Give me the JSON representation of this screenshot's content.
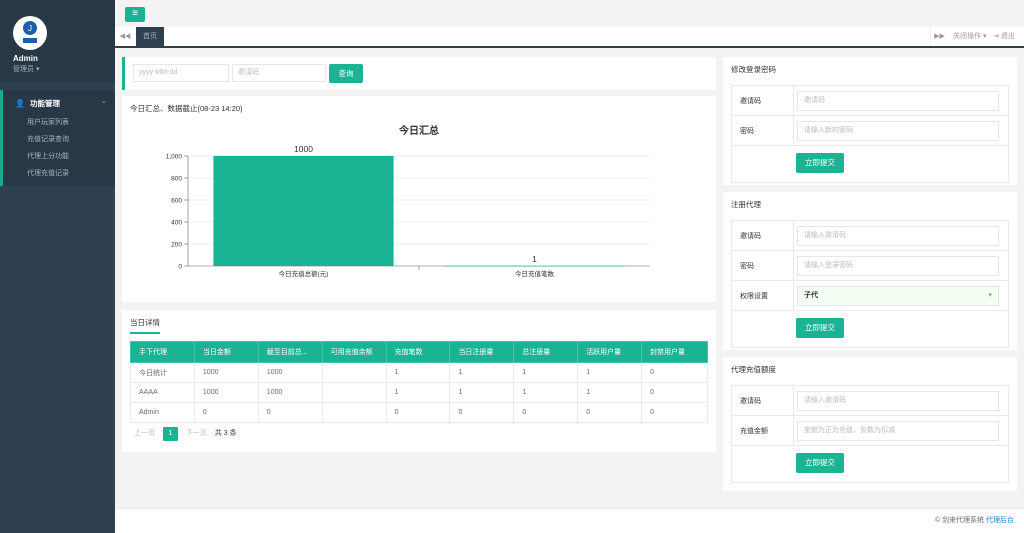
{
  "sidebar": {
    "user_name": "Admin",
    "user_role": "管理员",
    "menu_title": "功能管理",
    "items": [
      {
        "label": "用户玩家列表"
      },
      {
        "label": "充值记录查询"
      },
      {
        "label": "代理上分功能"
      },
      {
        "label": "代理充值记录"
      }
    ]
  },
  "tabs": {
    "home": "首页",
    "close_ops": "关闭操作",
    "exit": "退出"
  },
  "search": {
    "date_placeholder": "yyyy-MM-dd",
    "code_placeholder": "邀请码",
    "query_button": "查询"
  },
  "summary": {
    "header": "今日汇总、数据截止(08-23 14:20)"
  },
  "chart_data": {
    "type": "bar",
    "title": "今日汇总",
    "categories": [
      "今日充值总额(元)",
      "今日充值笔数"
    ],
    "values": [
      1000,
      1
    ],
    "data_labels": [
      "1000",
      "1"
    ],
    "yticks": [
      "0",
      "200",
      "400",
      "600",
      "800",
      "1,000"
    ],
    "ylim": [
      0,
      1000
    ],
    "color": "#1ab394",
    "grid": true
  },
  "detail": {
    "tab_label": "当日详情",
    "columns": [
      "手下代理",
      "当日金额",
      "截至目前总...",
      "可用充值余额",
      "充值笔数",
      "当日注册量",
      "总注册量",
      "活跃用户量",
      "封禁用户量"
    ],
    "rows": [
      [
        "今日统计",
        "1000",
        "1000",
        "",
        "1",
        "1",
        "1",
        "1",
        "0"
      ],
      [
        "AAAA",
        "1000",
        "1000",
        "",
        "1",
        "1",
        "1",
        "1",
        "0"
      ],
      [
        "Admin",
        "0",
        "0",
        "",
        "0",
        "0",
        "0",
        "0",
        "0"
      ]
    ],
    "pager": {
      "prev": "上一页",
      "page": "1",
      "next": "下一页",
      "total": "共 3 条"
    }
  },
  "forms": {
    "password": {
      "title": "修改登录密码",
      "code_label": "邀请码",
      "code_placeholder": "邀请码",
      "pwd_label": "密码",
      "pwd_placeholder": "请输入新的密码",
      "submit": "立即提交"
    },
    "register": {
      "title": "注册代理",
      "code_label": "邀请码",
      "code_placeholder": "请输入邀请码",
      "pwd_label": "密码",
      "pwd_placeholder": "请输入登录密码",
      "perm_label": "权限设置",
      "perm_value": "子代",
      "submit": "立即提交"
    },
    "recharge": {
      "title": "代理充值额度",
      "code_label": "邀请码",
      "code_placeholder": "请输入邀请码",
      "amount_label": "充值金额",
      "amount_placeholder": "金额为正为充值，负数为扣减",
      "submit": "立即提交"
    }
  },
  "footer": {
    "text": "© 剑来代理系统",
    "link": "代理后台"
  }
}
